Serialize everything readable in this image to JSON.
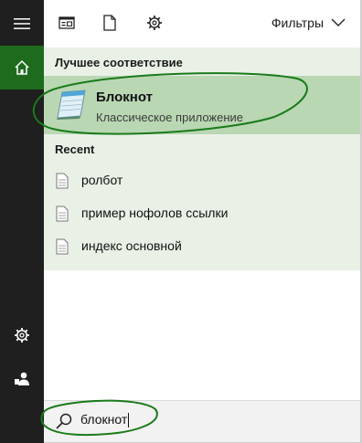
{
  "topbar": {
    "filters_label": "Фильтры"
  },
  "sections": {
    "best_match": "Лучшее соответствие",
    "recent": "Recent"
  },
  "best_match": {
    "title": "Блокнот",
    "subtitle": "Классическое приложение"
  },
  "recent": [
    {
      "label": "ролбот"
    },
    {
      "label": "пример нофолов ссылки"
    },
    {
      "label": "индекс основной"
    }
  ],
  "search": {
    "value": "блокнот"
  },
  "icons": {
    "menu": "hamburger-menu-icon",
    "home": "home-icon",
    "apps": "apps-icon",
    "documents": "document-icon",
    "settings": "gear-icon",
    "user": "user-icon",
    "chevron": "chevron-down-icon",
    "search": "search-icon"
  },
  "colors": {
    "rail_bg": "#1f1f1f",
    "home_active": "#1e6b1e",
    "results_bg": "#e9f1e7",
    "best_bg": "#b9d7b3",
    "annotation_stroke": "#1a7a1a"
  }
}
